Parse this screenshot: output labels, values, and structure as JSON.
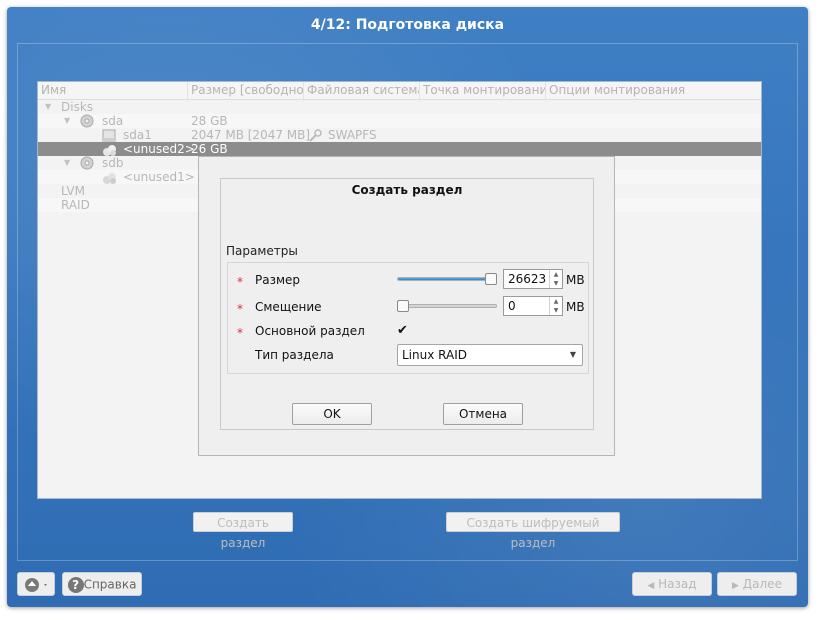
{
  "window": {
    "title": "4/12: Подготовка диска"
  },
  "tree": {
    "columns": [
      "Имя",
      "Размер [свободно]",
      "Файловая система",
      "Точка монтирования",
      "Опции монтирования"
    ],
    "rows": [
      {
        "name": "Disks",
        "size": "",
        "fs": ""
      },
      {
        "name": "sda",
        "size": "28 GB",
        "fs": ""
      },
      {
        "name": "sda1",
        "size": "2047 MB [2047 MB]",
        "fs": "SWAPFS"
      },
      {
        "name": "<unused2>",
        "size": "26 GB",
        "fs": ""
      },
      {
        "name": "sdb",
        "size": "",
        "fs": ""
      },
      {
        "name": "<unused1>",
        "size": "",
        "fs": ""
      },
      {
        "name": "LVM",
        "size": "",
        "fs": ""
      },
      {
        "name": "RAID",
        "size": "",
        "fs": ""
      }
    ],
    "selected_index": 3
  },
  "actions": {
    "create_partition": "Создать раздел",
    "create_encrypted": "Создать шифруемый раздел"
  },
  "footer": {
    "help": "Справка",
    "back": "Назад",
    "next": "Далее"
  },
  "dialog": {
    "title": "Создать раздел",
    "group_label": "Параметры",
    "required_mark": "*",
    "size": {
      "label": "Размер",
      "value": "26623",
      "unit": "MB",
      "slider_fraction": 1.0
    },
    "offset": {
      "label": "Смещение",
      "value": "0",
      "unit": "MB",
      "slider_fraction": 0.0
    },
    "primary": {
      "label": "Основной раздел",
      "checked": true,
      "mark": "✔"
    },
    "type": {
      "label": "Тип раздела",
      "value": "Linux RAID"
    },
    "ok": "OK",
    "cancel": "Отмена"
  },
  "colors": {
    "background": "#3574bb",
    "selection": "#8c8c8c",
    "required": "#d3333a"
  }
}
